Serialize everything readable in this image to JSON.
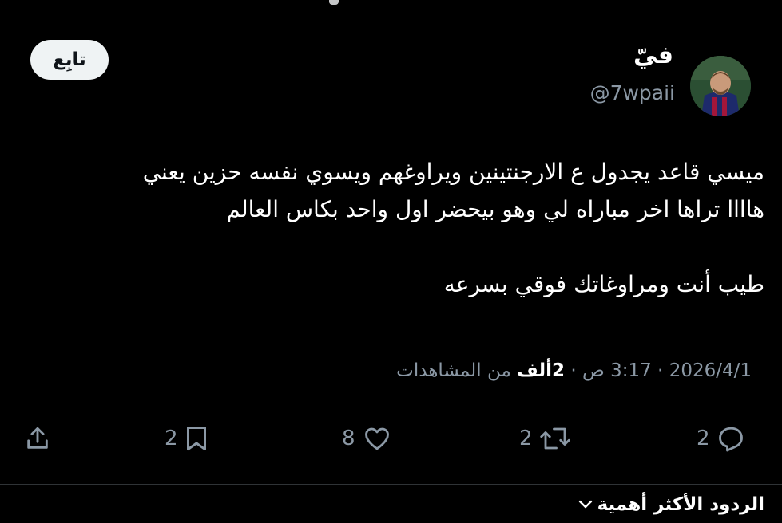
{
  "tweet": {
    "display_name": "فيّ",
    "handle": "@7wpaii",
    "follow_label": "تابِع",
    "text_line1": "ميسي قاعد يجدول ع الارجنتينين ويراوغهم ويسوي نفسه حزين يعني",
    "text_line2": "هاااا تراها اخر مباراه لي وهو بيحضر اول واحد بكاس العالم",
    "text_line3": "طيب أنت ومراوغاتك فوقي بسرعه",
    "date": "2026/4/1",
    "time": "3:17 ص",
    "views_count": "2ألف",
    "views_label": "من المشاهدات"
  },
  "actions": {
    "reply_count": "2",
    "retweet_count": "2",
    "like_count": "8",
    "bookmark_count": "2"
  },
  "replies": {
    "sort_label": "الردود الأكثر أهمية"
  },
  "colors": {
    "background": "#000000",
    "text_primary": "#ffffff",
    "text_secondary": "#8b98a5",
    "follow_bg": "#eff3f4"
  },
  "icons": [
    "reply-icon",
    "retweet-icon",
    "like-icon",
    "bookmark-icon",
    "share-icon",
    "chevron-down-icon"
  ]
}
